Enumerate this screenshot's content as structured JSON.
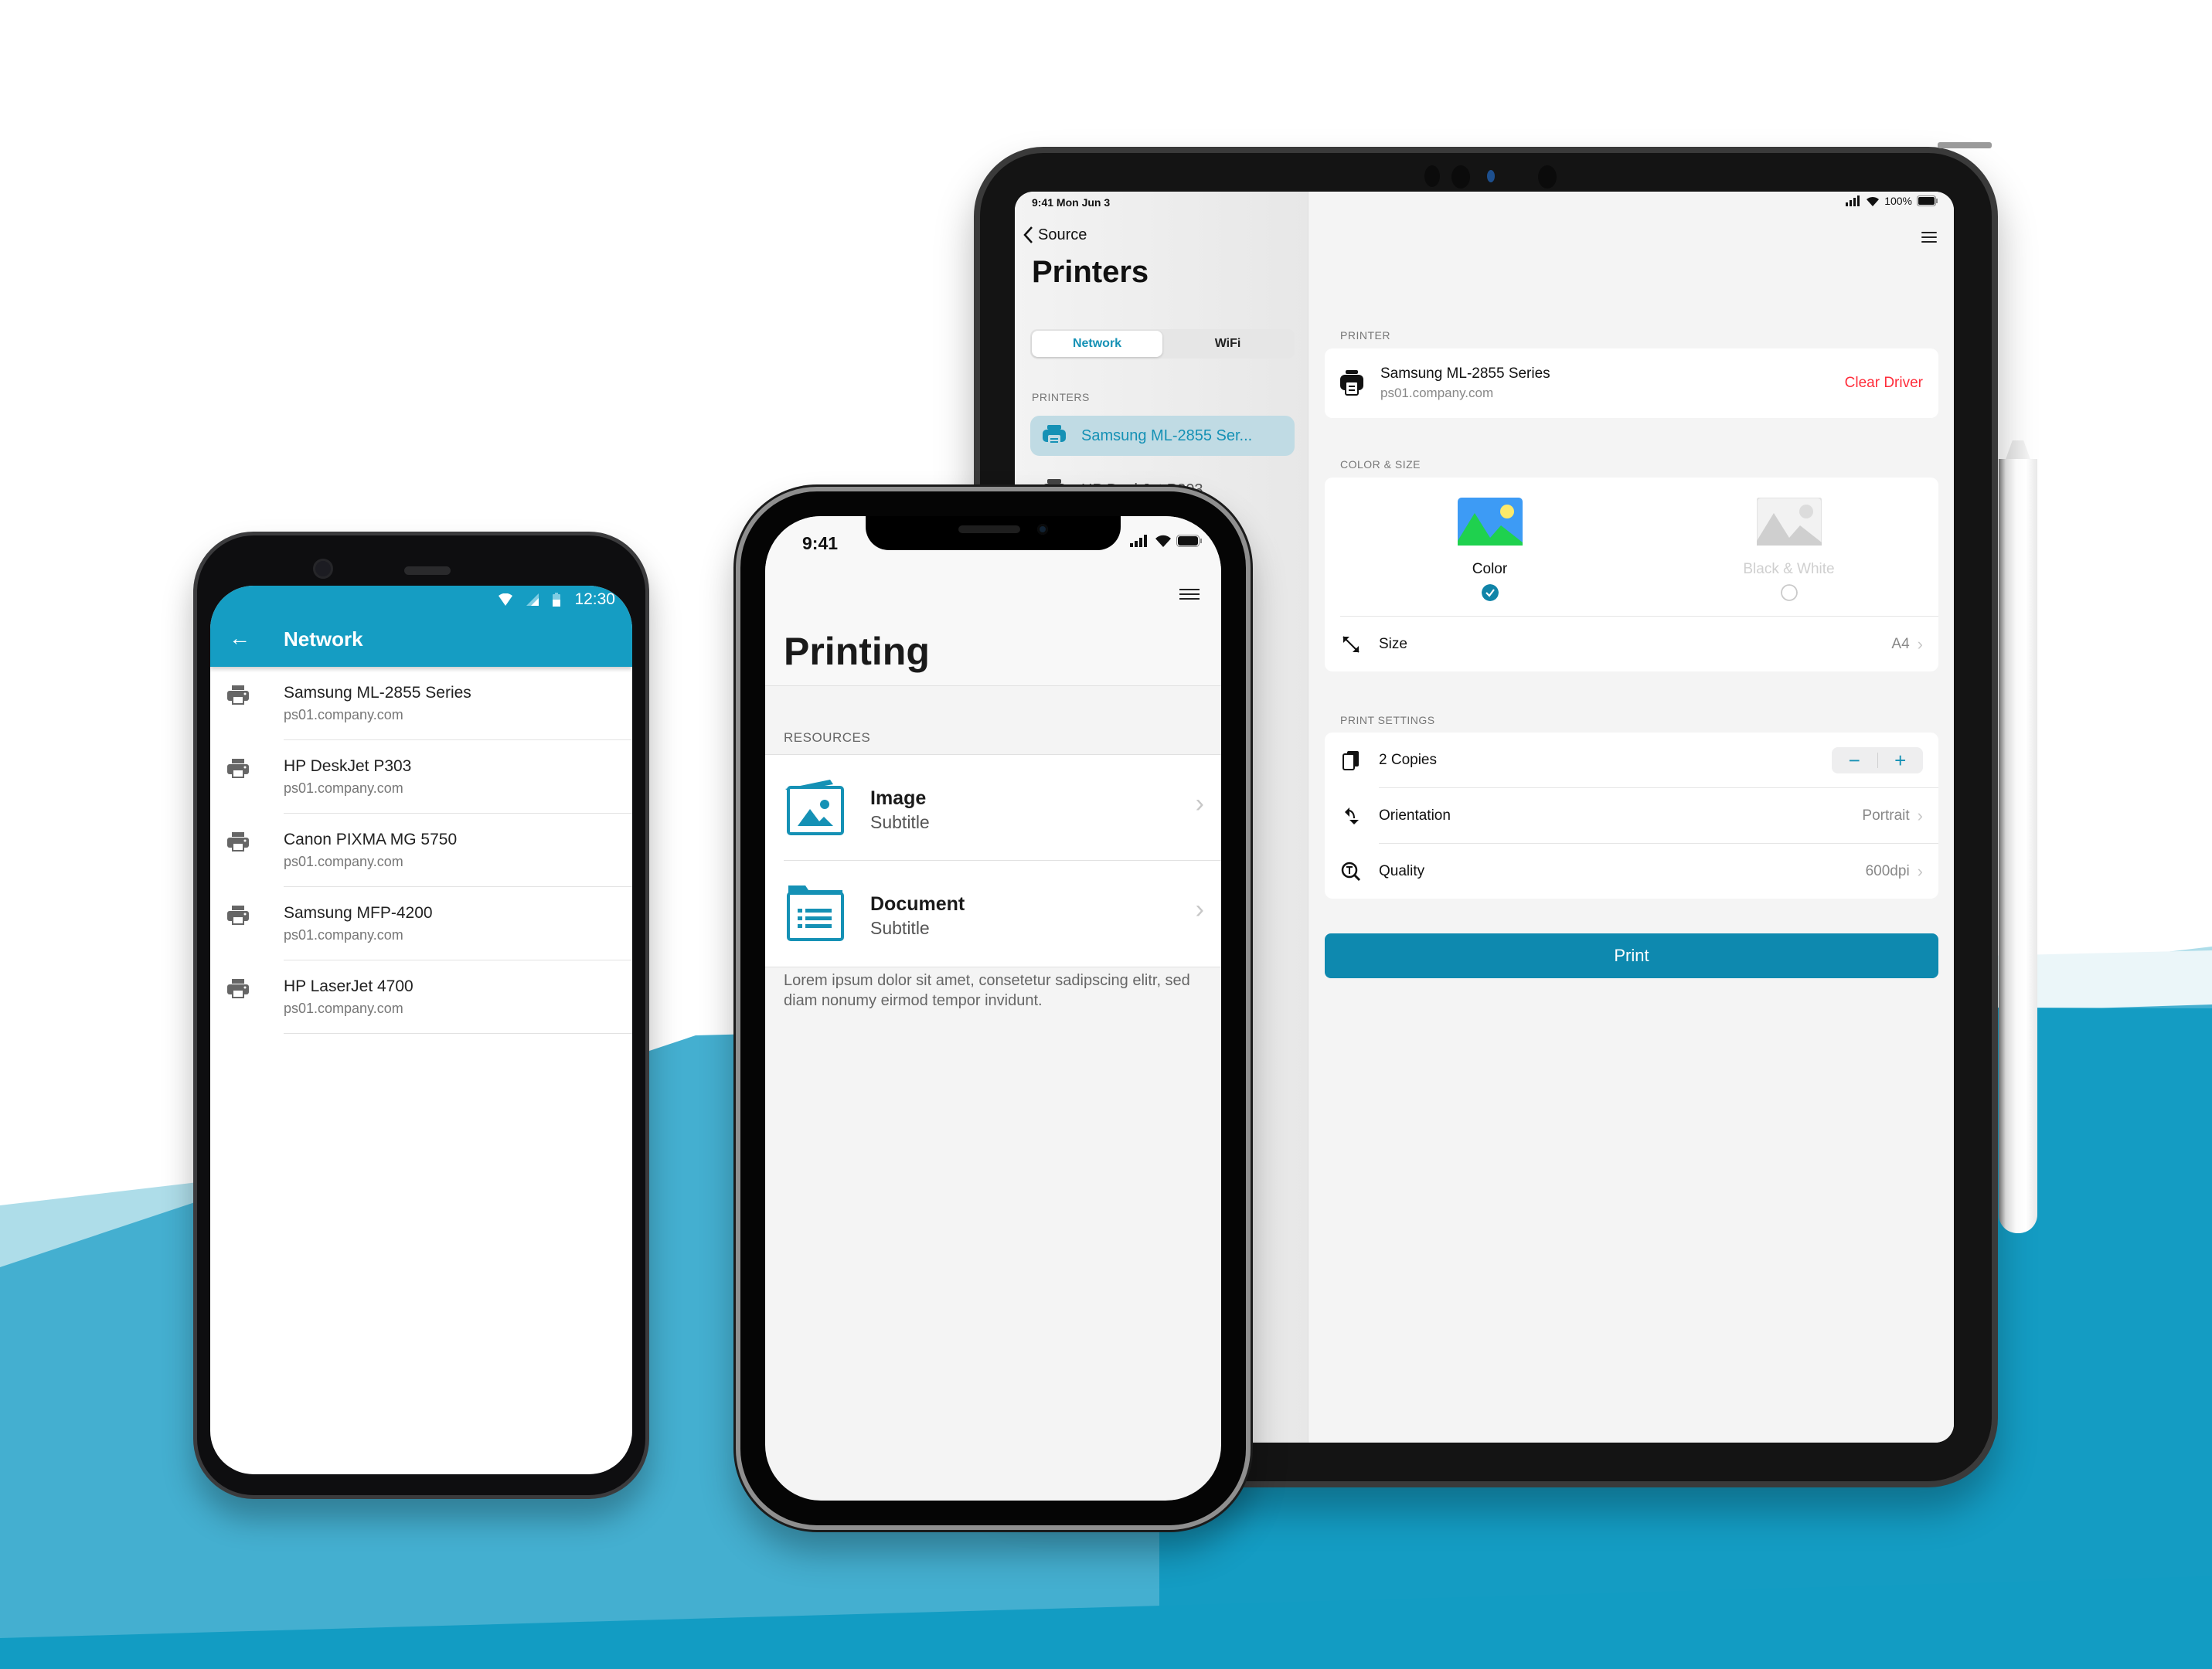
{
  "colors": {
    "brand": "#159dc3",
    "primary_button": "#0e89af",
    "destructive": "#ff2d3b",
    "bg_wave_light": "#aedde9",
    "bg_wave_mid": "#44afd0",
    "bg_wave_dark": "#129cc3"
  },
  "ipad": {
    "status": {
      "time_date": "9:41  Mon Jun 3",
      "battery": "100%"
    },
    "sidebar": {
      "back_label": "Source",
      "title": "Printers",
      "segments": [
        {
          "label": "Network",
          "active": true
        },
        {
          "label": "WiFi",
          "active": false
        }
      ],
      "section_label": "PRINTERS",
      "printers": [
        {
          "name": "Samsung ML-2855 Ser...",
          "selected": true
        },
        {
          "name": "HP DeskJet P303",
          "selected": false
        }
      ]
    },
    "detail": {
      "printer_section": "PRINTER",
      "printer": {
        "name": "Samsung ML-2855 Series",
        "host": "ps01.company.com",
        "action": "Clear Driver"
      },
      "color_section": "COLOR & SIZE",
      "color_options": [
        {
          "label": "Color",
          "selected": true
        },
        {
          "label": "Black & White",
          "selected": false
        }
      ],
      "size": {
        "label": "Size",
        "value": "A4"
      },
      "settings_section": "PRINT SETTINGS",
      "copies": {
        "label": "2 Copies",
        "count": 2,
        "minus": "−",
        "plus": "+"
      },
      "orientation": {
        "label": "Orientation",
        "value": "Portrait"
      },
      "quality": {
        "label": "Quality",
        "value": "600dpi"
      },
      "print_button": "Print"
    }
  },
  "android": {
    "status": {
      "time": "12:30"
    },
    "toolbar": {
      "title": "Network",
      "back_icon": "←"
    },
    "printers": [
      {
        "name": "Samsung ML-2855 Series",
        "host": "ps01.company.com"
      },
      {
        "name": "HP DeskJet P303",
        "host": "ps01.company.com"
      },
      {
        "name": "Canon PIXMA MG 5750",
        "host": "ps01.company.com"
      },
      {
        "name": "Samsung MFP-4200",
        "host": "ps01.company.com"
      },
      {
        "name": "HP LaserJet 4700",
        "host": "ps01.company.com"
      }
    ]
  },
  "iphone": {
    "status": {
      "time": "9:41"
    },
    "title": "Printing",
    "section_label": "RESOURCES",
    "resources": [
      {
        "title": "Image",
        "subtitle": "Subtitle",
        "icon": "image-icon"
      },
      {
        "title": "Document",
        "subtitle": "Subtitle",
        "icon": "document-icon"
      }
    ],
    "footer": "Lorem ipsum dolor sit amet, consetetur sadipscing elitr, sed diam nonumy eirmod tempor invidunt.",
    "chevron": "›"
  }
}
